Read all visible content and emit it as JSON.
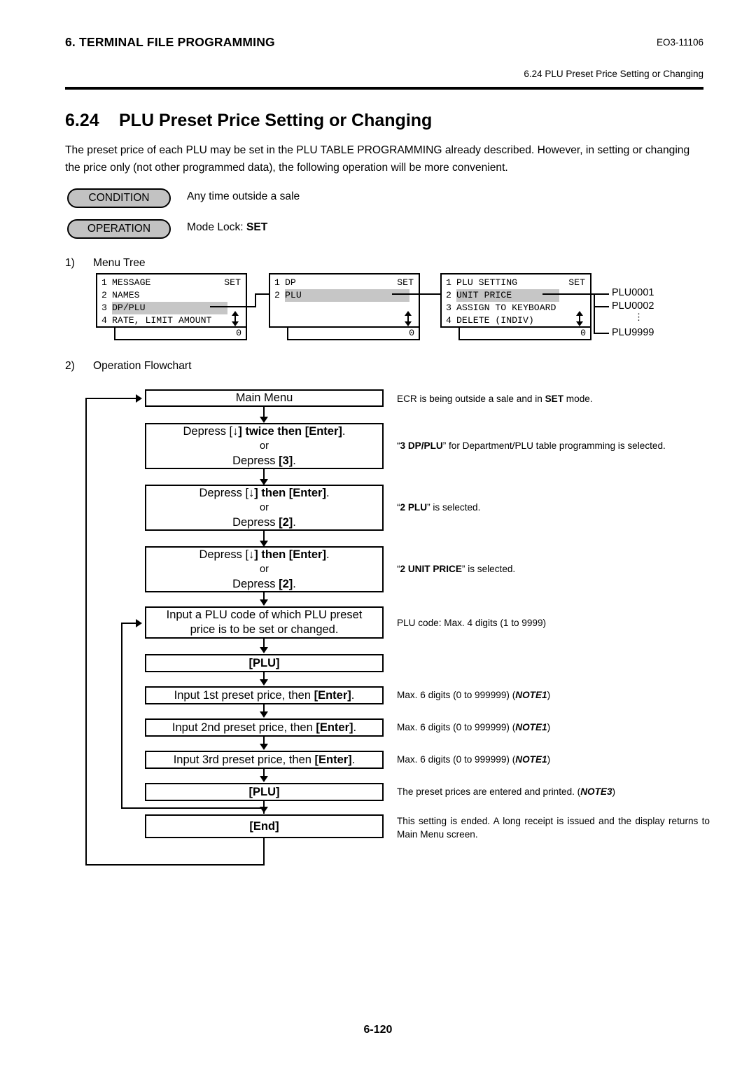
{
  "header": {
    "chapter": "6. TERMINAL FILE PROGRAMMING",
    "doc_code": "EO3-11106",
    "running_head": "6.24 PLU Preset Price Setting or Changing"
  },
  "section": {
    "number": "6.24",
    "title": "PLU Preset Price Setting or Changing",
    "intro": "The preset price of each PLU may be set in the PLU TABLE PROGRAMMING already described.  However, in setting or changing the price only (not other programmed data), the following operation will be more convenient."
  },
  "pills": {
    "condition_label": "CONDITION",
    "condition_text": "Any time outside a sale",
    "operation_label": "OPERATION",
    "operation_text_prefix": "Mode Lock: ",
    "operation_text_bold": "SET"
  },
  "steps": {
    "one_num": "1)",
    "one_label": "Menu Tree",
    "two_num": "2)",
    "two_label": "Operation Flowchart"
  },
  "menu_tree": {
    "screen1": {
      "rows": [
        {
          "index": "1",
          "text": "MESSAGE",
          "highlight": false
        },
        {
          "index": "2",
          "text": "NAMES",
          "highlight": false
        },
        {
          "index": "3",
          "text": "DP/PLU",
          "highlight": true
        },
        {
          "index": "4",
          "text": "RATE, LIMIT AMOUNT",
          "highlight": false
        }
      ],
      "mode": "SET",
      "value": "0"
    },
    "screen2": {
      "rows": [
        {
          "index": "1",
          "text": "DP",
          "highlight": false
        },
        {
          "index": "2",
          "text": "PLU",
          "highlight": true
        }
      ],
      "mode": "SET",
      "value": "0"
    },
    "screen3": {
      "rows": [
        {
          "index": "1",
          "text": "PLU SETTING",
          "highlight": false
        },
        {
          "index": "2",
          "text": "UNIT PRICE",
          "highlight": true
        },
        {
          "index": "3",
          "text": "ASSIGN TO KEYBOARD",
          "highlight": false
        },
        {
          "index": "4",
          "text": "DELETE (INDIV)",
          "highlight": false
        }
      ],
      "mode": "SET",
      "value": "0"
    },
    "plu_outputs": {
      "first": "PLU0001",
      "second": "PLU0002",
      "last": "PLU9999"
    }
  },
  "flowchart": {
    "boxes": {
      "main_menu": "Main Menu",
      "step1_line1_a": "Depress [",
      "step1_line1_arrow": "↓",
      "step1_line1_b": "] twice then ",
      "step1_line1_enter": "[Enter]",
      "step1_line1_c": ".",
      "step_or": "or",
      "step1_line3_a": "Depress ",
      "step1_line3_key": "[3]",
      "step1_line3_b": ".",
      "step2_line1_a": "Depress [",
      "step2_line1_arrow": "↓",
      "step2_line1_b": "] then ",
      "step2_line1_enter": "[Enter]",
      "step2_line1_c": ".",
      "step2_line3_a": "Depress ",
      "step2_line3_key": "[2]",
      "step2_line3_b": ".",
      "step3_line1_a": "Depress [",
      "step3_line1_arrow": "↓",
      "step3_line1_b": "] then ",
      "step3_line1_enter": "[Enter]",
      "step3_line1_c": ".",
      "step3_line3_a": "Depress ",
      "step3_line3_key": "[2]",
      "step3_line3_b": ".",
      "plu_code_line1": "Input a PLU code of which PLU preset",
      "plu_code_line2": "price is to be set or changed.",
      "plu_key_1": "[PLU]",
      "price1_a": "Input 1st preset price, then ",
      "price1_enter": "[Enter]",
      "price1_b": ".",
      "price2_a": "Input 2nd preset price, then ",
      "price2_enter": "[Enter]",
      "price2_b": ".",
      "price3_a": "Input 3rd preset price, then ",
      "price3_enter": "[Enter]",
      "price3_b": ".",
      "plu_key_2": "[PLU]",
      "end_key": "[End]"
    },
    "notes": {
      "main_menu_a": "ECR is being outside a sale and in ",
      "main_menu_bold": "SET",
      "main_menu_b": " mode.",
      "step1_bold": "3 DP/PLU",
      "step1_a": "“",
      "step1_b": "” for Department/PLU table programming is selected.",
      "step2_a": "“",
      "step2_bold": "2 PLU",
      "step2_b": "” is selected.",
      "step3_a": "“",
      "step3_bold": "2 UNIT PRICE",
      "step3_b": "” is selected.",
      "plu_code": "PLU code: Max. 4 digits (1 to 9999)",
      "price_a": "Max. 6 digits (0 to 999999) (",
      "price_note": "NOTE1",
      "price_b": ")",
      "plu_key_a": "The preset prices are entered and printed. (",
      "plu_key_note": "NOTE3",
      "plu_key_b": ")",
      "end_text": "This setting is ended.  A long receipt is issued and the display returns to Main Menu screen."
    }
  },
  "footer": {
    "page_number": "6-120"
  },
  "colors": {
    "highlight": "#c6c6c6",
    "pill_fill": "#c2c2c2",
    "line": "#000000"
  }
}
